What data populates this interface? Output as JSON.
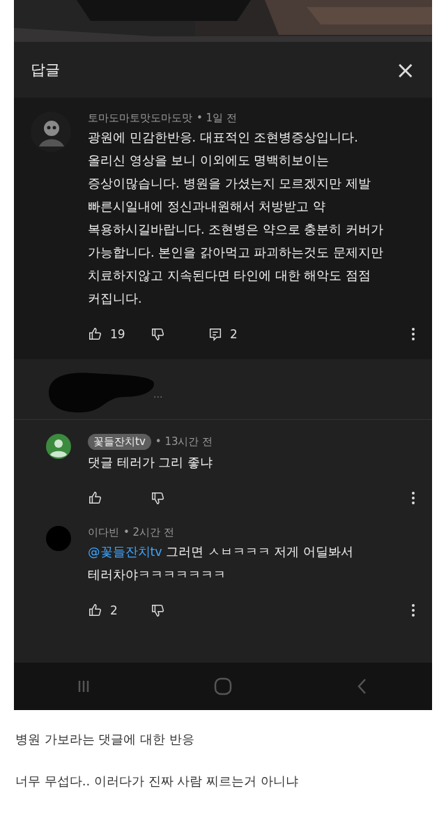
{
  "panel": {
    "title": "답글",
    "close": "×"
  },
  "comment": {
    "author": "토마도마토맛도마도맛",
    "time": "• 1일 전",
    "text": "광원에 민감한반응. 대표적인 조현병증상입니다.\n올리신 영상을 보니 이외에도 명백히보이는\n증상이많습니다. 병원을 가셨는지 모르겠지만 제발\n빠른시일내에 정신과내원해서 처방받고 약\n복용하시길바랍니다. 조현병은 약으로 충분히 커버가\n가능합니다. 본인을 갉아먹고 파괴하는것도 문제지만\n치료하지않고 지속된다면 타인에 대한 해악도 점점\n커집니다.",
    "likes": "19",
    "replies": "2"
  },
  "hidden_reply": {
    "tail": "..."
  },
  "replies": [
    {
      "author": "꽃들잔치tv",
      "author_badge": true,
      "avatar": {
        "kind": "default"
      },
      "time": "• 13시간 전",
      "text": "댓글 테러가 그리 좋냐"
    },
    {
      "author": "이다빈",
      "author_badge": false,
      "avatar": {
        "kind": "dark"
      },
      "time": "• 2시간 전",
      "mention": "@꽃들잔치tv",
      "text": "그러면 ㅅㅂㅋㅋㅋ 저게 어딜봐서\n테러차야ㅋㅋㅋㅋㅋㅋㅋ",
      "likes": "2"
    }
  ],
  "caption": [
    "병원 가보라는 댓글에 대한 반응",
    "너무 무섭다.. 이러다가 진짜 사람 찌르는거 아니냐"
  ]
}
